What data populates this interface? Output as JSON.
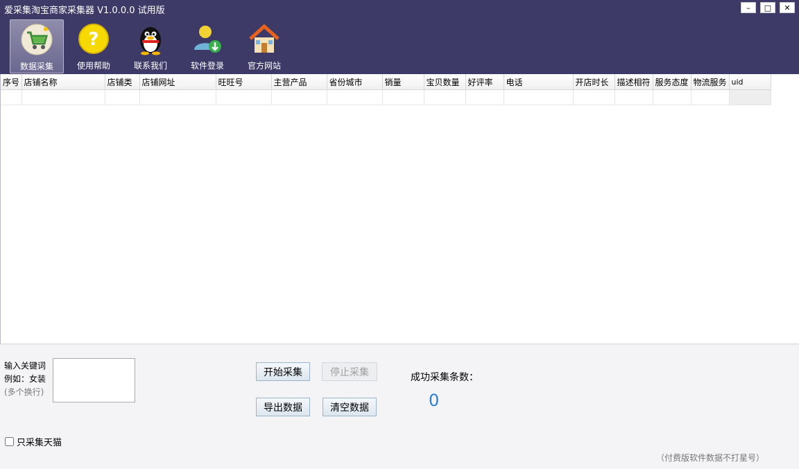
{
  "window": {
    "title": "爱采集淘宝商家采集器 V1.0.0.0 试用版",
    "minimize": "–",
    "maximize": "□",
    "close": "✕"
  },
  "toolbar": [
    {
      "label": "数据采集",
      "icon": "shopping-cart-icon",
      "active": true
    },
    {
      "label": "使用帮助",
      "icon": "help-question-icon",
      "active": false
    },
    {
      "label": "联系我们",
      "icon": "qq-penguin-icon",
      "active": false
    },
    {
      "label": "软件登录",
      "icon": "user-login-icon",
      "active": false
    },
    {
      "label": "官方网站",
      "icon": "home-house-icon",
      "active": false
    }
  ],
  "table": {
    "columns": [
      "序号",
      "店铺名称",
      "店铺类",
      "店铺网址",
      "旺旺号",
      "主营产品",
      "省份城市",
      "销量",
      "宝贝数量",
      "好评率",
      "电话",
      "开店时长",
      "描述相符",
      "服务态度",
      "物流服务",
      "uid"
    ]
  },
  "panel": {
    "keyword_label": "输入关键词",
    "keyword_example": "例如：女装",
    "keyword_hint": "(多个换行)",
    "keyword_value": "",
    "start_button": "开始采集",
    "stop_button": "停止采集",
    "export_button": "导出数据",
    "clear_button": "清空数据",
    "count_label": "成功采集条数：",
    "count_value": "0",
    "tmall_only_label": "只采集天猫",
    "tmall_only_checked": false,
    "footnote": "（付费版软件数据不打星号）"
  },
  "colors": {
    "topbar": "#3e3a67",
    "count": "#2a7fd4"
  }
}
